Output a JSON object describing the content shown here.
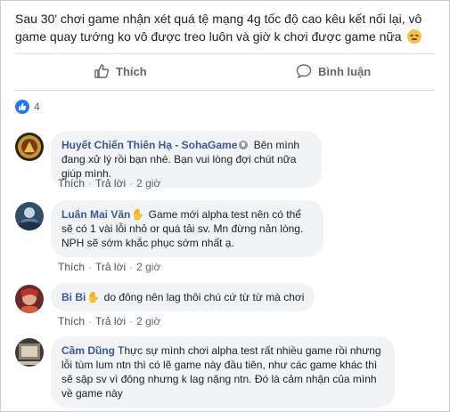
{
  "post": {
    "text": "Sau 30' chơi game nhận xét quá tệ mạng 4g tốc độ cao kêu kết nối lại, vô game quay tướng ko vô được treo luôn và giờ k chơi được game nữa",
    "emoji": "disappointed-face"
  },
  "actions": {
    "like_label": "Thích",
    "comment_label": "Bình luận"
  },
  "reactions": {
    "count": "4"
  },
  "comment_meta": {
    "like": "Thích",
    "reply": "Trả lời",
    "separator": "·"
  },
  "comments": [
    {
      "author": "Huyết Chiến Thiên Hạ - SohaGame",
      "text": "Bên mình đang xử lý rồi bạn nhé. Bạn vui lòng đợi chút nữa giúp mình.",
      "time": "2 giờ"
    },
    {
      "author": "Luân Mai Văn",
      "text": "Game mới alpha test nên có thể sẽ có 1 vài lỗi nhỏ or quá tải sv. Mn đừng nản lòng. NPH sẽ sớm khắc phục sớm nhất ạ.",
      "time": "2 giờ"
    },
    {
      "author": "Bi Bi",
      "text": "do đông nên lag thôi chú cứ từ từ mà chơi",
      "time": "2 giờ"
    },
    {
      "author": "Cầm Dũng",
      "text": "Thực sự mình chơi alpha test rất nhiều game rồi nhưng lỗi tùm lum ntn thì có lẽ game này đầu tiên, như các game khác thì sẽ sập sv vì đông nhưng k lag nặng ntn. Đó là cảm nhận của mình về game này"
    }
  ],
  "colors": {
    "link": "#385898",
    "meta": "#606770",
    "bubble": "#f2f3f5",
    "like_blue": "#2078f4"
  }
}
